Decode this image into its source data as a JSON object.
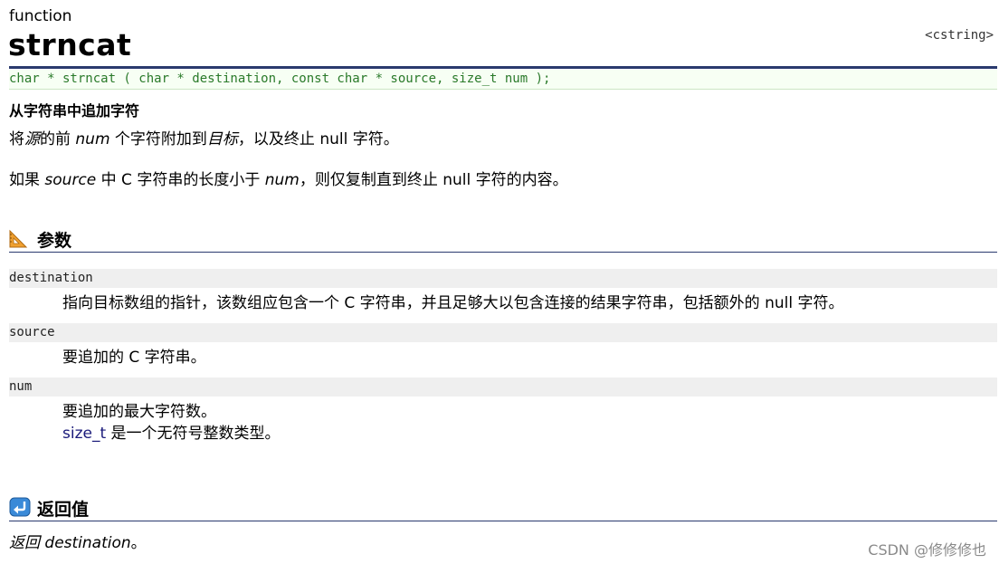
{
  "header": {
    "kind": "function",
    "name": "strncat",
    "header_file": "<cstring>"
  },
  "prototype": "char * strncat ( char * destination, const char * source, size_t num );",
  "description": {
    "title": "从字符串中追加字符",
    "line1": {
      "p1": "将",
      "p2": "源",
      "p3": "的前 ",
      "p4": "num",
      "p5": " 个字符附加到",
      "p6": "目标",
      "p7": "，以及终止 null 字符。"
    },
    "line2": {
      "p1": "如果 ",
      "p2": "source",
      "p3": " 中 C 字符串的长度小于 ",
      "p4": "num",
      "p5": "，则仅复制直到终止 null 字符的内容。"
    }
  },
  "params_section": {
    "title": "参数",
    "icon": "ruler-triangle-icon",
    "items": [
      {
        "name": "destination",
        "desc": "指向目标数组的指针，该数组应包含一个 C 字符串，并且足够大以包含连接的结果字符串，包括额外的 null 字符。"
      },
      {
        "name": "source",
        "desc": "要追加的 C 字符串。"
      },
      {
        "name": "num",
        "desc": "要追加的最大字符数。",
        "extra_link": "size_t",
        "extra_text": " 是一个无符号整数类型。"
      }
    ]
  },
  "return_section": {
    "title": "返回值",
    "icon": "return-arrow-icon",
    "text_italic": "返回 destination",
    "text_plain": "。"
  },
  "watermark": "CSDN @修修修也",
  "colors": {
    "rule": "#2a3a6e",
    "prototype_text": "#2a7a2a",
    "param_bg": "#efefef",
    "link": "#1a1a7a"
  }
}
